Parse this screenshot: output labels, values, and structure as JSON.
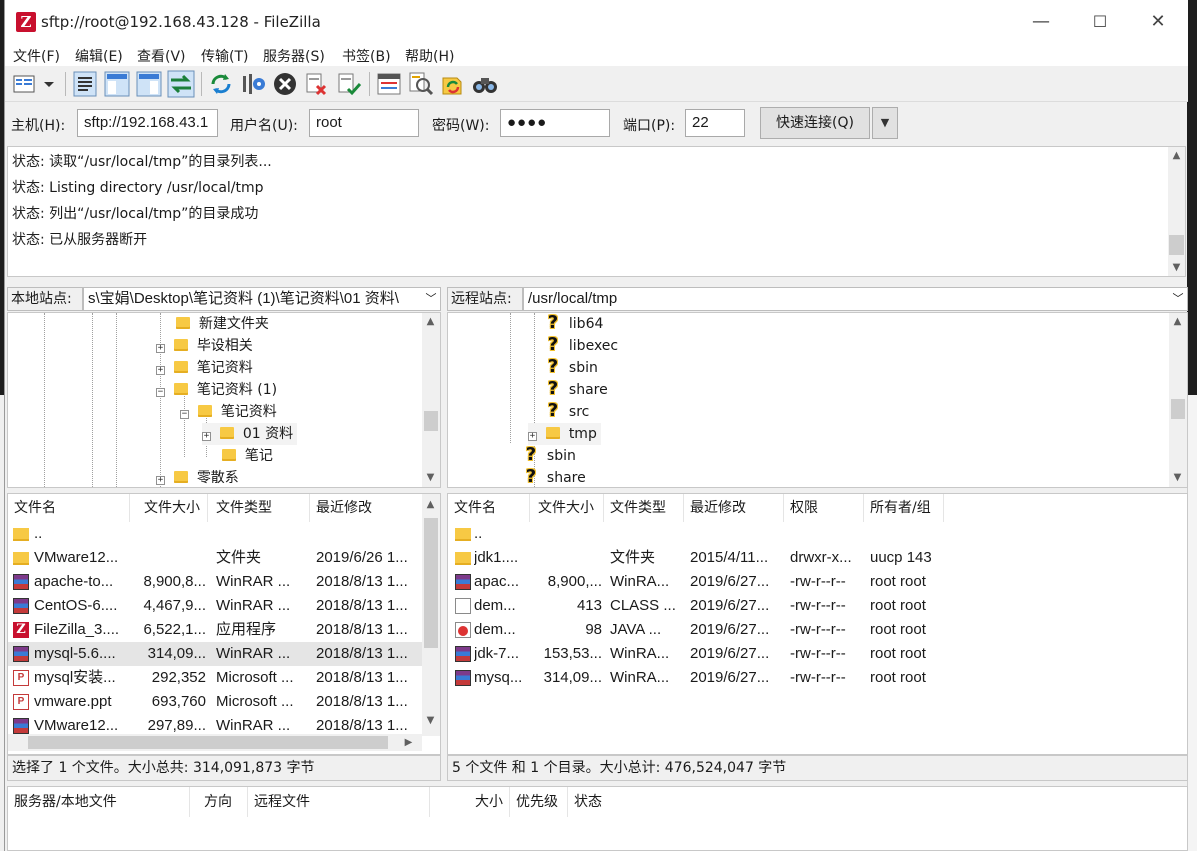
{
  "window": {
    "title": "sftp://root@192.168.43.128 - FileZilla",
    "icon_letter": "Z",
    "min_glyph": "—",
    "max_glyph": "☐",
    "close_glyph": "✕"
  },
  "menu": [
    "文件(F)",
    "编辑(E)",
    "查看(V)",
    "传输(T)",
    "服务器(S)",
    "书签(B)",
    "帮助(H)"
  ],
  "toolbar": {
    "icons": [
      "site-manager-icon",
      "toggle-log-icon",
      "toggle-local-tree-icon",
      "toggle-remote-tree-icon",
      "toggle-queue-icon",
      "refresh-icon",
      "process-queue-icon",
      "cancel-icon",
      "disconnect-icon",
      "reconnect-icon",
      "filter-icon",
      "compare-icon",
      "sync-browse-icon",
      "search-icon"
    ]
  },
  "quickconnect": {
    "host_label": "主机(H):",
    "host_value": "sftp://192.168.43.1",
    "user_label": "用户名(U):",
    "user_value": "root",
    "pass_label": "密码(W):",
    "pass_value": "●●●●",
    "port_label": "端口(P):",
    "port_value": "22",
    "connect_label": "快速连接(Q)",
    "dropdown_glyph": "▼"
  },
  "log": [
    {
      "label": "状态:",
      "text": "读取“/usr/local/tmp”的目录列表..."
    },
    {
      "label": "状态:",
      "text": "Listing directory /usr/local/tmp"
    },
    {
      "label": "状态:",
      "text": "列出“/usr/local/tmp”的目录成功"
    },
    {
      "label": "状态:",
      "text": "已从服务器断开"
    }
  ],
  "local": {
    "site_label": "本地站点:",
    "path": "s\\宝娟\\Desktop\\笔记资料 (1)\\笔记资料\\01 资料\\",
    "tree": [
      {
        "label": "新建文件夹",
        "expander": ""
      },
      {
        "label": "毕设相关",
        "expander": "+"
      },
      {
        "label": "笔记资料",
        "expander": "+"
      },
      {
        "label": "笔记资料 (1)",
        "expander": "−"
      },
      {
        "label": "笔记资料",
        "expander": "−"
      },
      {
        "label": "01 资料",
        "expander": "+"
      },
      {
        "label": "笔记",
        "expander": ""
      },
      {
        "label": "零散系",
        "expander": "+"
      }
    ],
    "columns": [
      "文件名",
      "文件大小",
      "文件类型",
      "最近修改"
    ],
    "files": [
      {
        "name": "..",
        "size": "",
        "type": "",
        "modified": "",
        "icon": "folder-icon"
      },
      {
        "name": "VMware12...",
        "size": "",
        "type": "文件夹",
        "modified": "2019/6/26 1...",
        "icon": "folder-icon"
      },
      {
        "name": "apache-to...",
        "size": "8,900,8...",
        "type": "WinRAR ...",
        "modified": "2018/8/13 1...",
        "icon": "rar-icon"
      },
      {
        "name": "CentOS-6....",
        "size": "4,467,9...",
        "type": "WinRAR ...",
        "modified": "2018/8/13 1...",
        "icon": "rar-icon"
      },
      {
        "name": "FileZilla_3....",
        "size": "6,522,1...",
        "type": "应用程序",
        "modified": "2018/8/13 1...",
        "icon": "filezilla-icon"
      },
      {
        "name": "mysql-5.6....",
        "size": "314,09...",
        "type": "WinRAR ...",
        "modified": "2018/8/13 1...",
        "icon": "rar-icon",
        "selected": true
      },
      {
        "name": "mysql安装...",
        "size": "292,352",
        "type": "Microsoft ...",
        "modified": "2018/8/13 1...",
        "icon": "ppt-icon"
      },
      {
        "name": "vmware.ppt",
        "size": "693,760",
        "type": "Microsoft ...",
        "modified": "2018/8/13 1...",
        "icon": "ppt-icon"
      },
      {
        "name": "VMware12...",
        "size": "297,89...",
        "type": "WinRAR ...",
        "modified": "2018/8/13 1...",
        "icon": "rar-icon"
      }
    ],
    "status": "选择了 1 个文件。大小总共: 314,091,873 字节"
  },
  "remote": {
    "site_label": "远程站点:",
    "path": "/usr/local/tmp",
    "tree": [
      {
        "label": "lib64",
        "icon": "q",
        "expander": ""
      },
      {
        "label": "libexec",
        "icon": "q",
        "expander": ""
      },
      {
        "label": "sbin",
        "icon": "q",
        "expander": ""
      },
      {
        "label": "share",
        "icon": "q",
        "expander": ""
      },
      {
        "label": "src",
        "icon": "q",
        "expander": ""
      },
      {
        "label": "tmp",
        "icon": "folder",
        "expander": "+"
      },
      {
        "label": "sbin",
        "icon": "q",
        "expander": ""
      },
      {
        "label": "share",
        "icon": "q",
        "expander": ""
      }
    ],
    "columns": [
      "文件名",
      "文件大小",
      "文件类型",
      "最近修改",
      "权限",
      "所有者/组"
    ],
    "files": [
      {
        "name": "..",
        "size": "",
        "type": "",
        "modified": "",
        "perm": "",
        "owner": "",
        "icon": "folder-icon"
      },
      {
        "name": "jdk1....",
        "size": "",
        "type": "文件夹",
        "modified": "2015/4/11...",
        "perm": "drwxr-x...",
        "owner": "uucp 143",
        "icon": "folder-icon"
      },
      {
        "name": "apac...",
        "size": "8,900,...",
        "type": "WinRA...",
        "modified": "2019/6/27...",
        "perm": "-rw-r--r--",
        "owner": "root root",
        "icon": "rar-icon"
      },
      {
        "name": "dem...",
        "size": "413",
        "type": "CLASS ...",
        "modified": "2019/6/27...",
        "perm": "-rw-r--r--",
        "owner": "root root",
        "icon": "file-icon"
      },
      {
        "name": "dem...",
        "size": "98",
        "type": "JAVA ...",
        "modified": "2019/6/27...",
        "perm": "-rw-r--r--",
        "owner": "root root",
        "icon": "java-icon"
      },
      {
        "name": "jdk-7...",
        "size": "153,53...",
        "type": "WinRA...",
        "modified": "2019/6/27...",
        "perm": "-rw-r--r--",
        "owner": "root root",
        "icon": "rar-icon"
      },
      {
        "name": "mysq...",
        "size": "314,09...",
        "type": "WinRA...",
        "modified": "2019/6/27...",
        "perm": "-rw-r--r--",
        "owner": "root root",
        "icon": "rar-icon"
      }
    ],
    "status": "5 个文件 和 1 个目录。大小总计: 476,524,047 字节"
  },
  "queue": {
    "columns": [
      "服务器/本地文件",
      "方向",
      "远程文件",
      "大小",
      "优先级",
      "状态"
    ]
  }
}
